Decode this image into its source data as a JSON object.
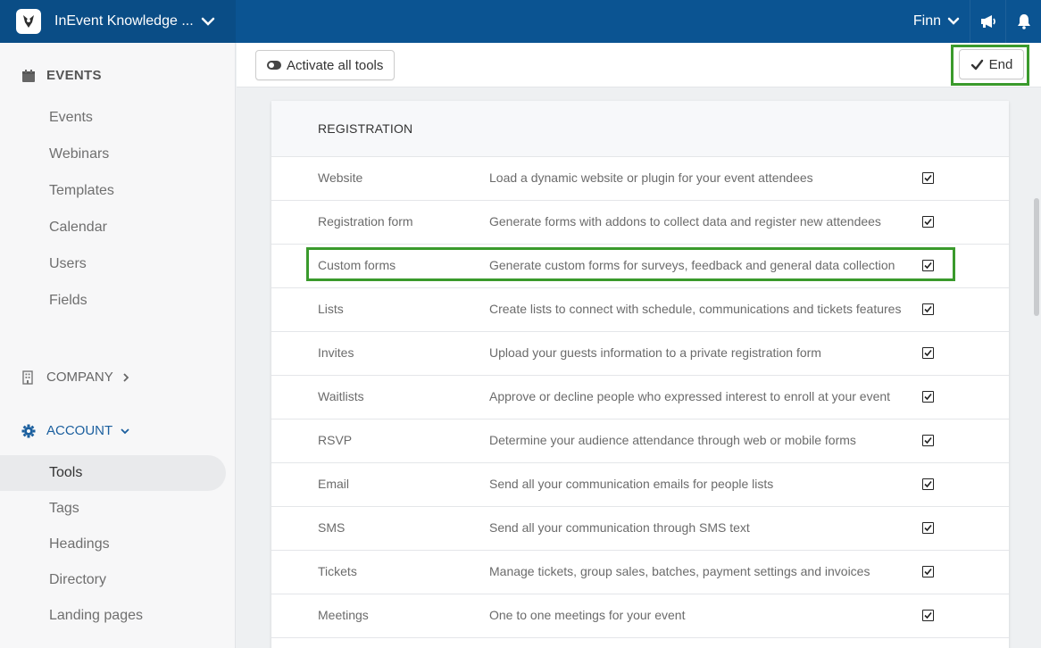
{
  "app": {
    "brand_name": "InEvent Knowledge ...",
    "user_name": "Finn"
  },
  "toolbar": {
    "activate_label": "Activate all tools",
    "end_label": "End"
  },
  "sidebar": {
    "events_heading": "EVENTS",
    "events_items": [
      "Events",
      "Webinars",
      "Templates",
      "Calendar",
      "Users",
      "Fields"
    ],
    "company_heading": "COMPANY",
    "account_heading": "ACCOUNT",
    "account_items": [
      "Tools",
      "Tags",
      "Headings",
      "Directory",
      "Landing pages"
    ],
    "active_item": "Tools"
  },
  "registration": {
    "heading": "REGISTRATION",
    "rows": [
      {
        "name": "Website",
        "description": "Load a dynamic website or plugin for your event attendees",
        "checked": true
      },
      {
        "name": "Registration form",
        "description": "Generate forms with addons to collect data and register new attendees",
        "checked": true
      },
      {
        "name": "Custom forms",
        "description": "Generate custom forms for surveys, feedback and general data collection",
        "checked": true
      },
      {
        "name": "Lists",
        "description": "Create lists to connect with schedule, communications and tickets features",
        "checked": true
      },
      {
        "name": "Invites",
        "description": "Upload your guests information to a private registration form",
        "checked": true
      },
      {
        "name": "Waitlists",
        "description": "Approve or decline people who expressed interest to enroll at your event",
        "checked": true
      },
      {
        "name": "RSVP",
        "description": "Determine your audience attendance through web or mobile forms",
        "checked": true
      },
      {
        "name": "Email",
        "description": "Send all your communication emails for people lists",
        "checked": true
      },
      {
        "name": "SMS",
        "description": "Send all your communication through SMS text",
        "checked": true
      },
      {
        "name": "Tickets",
        "description": "Manage tickets, group sales, batches, payment settings and invoices",
        "checked": true
      },
      {
        "name": "Meetings",
        "description": "One to one meetings for your event",
        "checked": true
      }
    ]
  },
  "colors": {
    "topbar": "#0b5492",
    "highlight": "#3a9a2c",
    "account_accent": "#1b5f9e"
  }
}
